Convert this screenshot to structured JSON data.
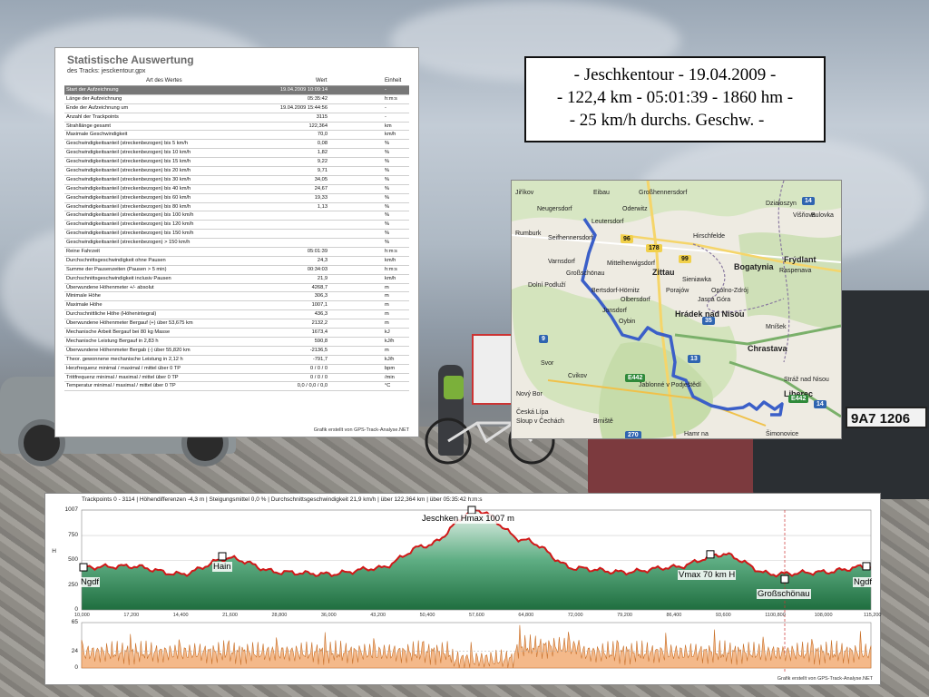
{
  "stats": {
    "title": "Statistische Auswertung",
    "subtitle": "des Tracks: jesckentour.gpx",
    "headers": [
      "Art des Wertes",
      "Wert",
      "Einheit"
    ],
    "rows": [
      {
        "label": "Start der Aufzeichnung",
        "value": "19.04.2009 10:09:14",
        "unit": "-",
        "selected": true
      },
      {
        "label": "Länge der Aufzeichnung",
        "value": "05:35:42",
        "unit": "h:m:s"
      },
      {
        "label": "Ende der Aufzeichnung um",
        "value": "19.04.2009 15:44:56",
        "unit": "-"
      },
      {
        "label": "Anzahl der Trackpoints",
        "value": "3115",
        "unit": "-"
      },
      {
        "label": "Strahllänge gesamt",
        "value": "122,364",
        "unit": "km"
      },
      {
        "label": "Maximale Geschwindigkeit",
        "value": "70,0",
        "unit": "km/h"
      },
      {
        "label": "Geschwindigkeitsanteil  (streckenbezogen)    bis      5 km/h",
        "value": "0,08",
        "unit": "%"
      },
      {
        "label": "Geschwindigkeitsanteil  (streckenbezogen)    bis    10 km/h",
        "value": "1,82",
        "unit": "%"
      },
      {
        "label": "Geschwindigkeitsanteil  (streckenbezogen)    bis    15 km/h",
        "value": "9,22",
        "unit": "%"
      },
      {
        "label": "Geschwindigkeitsanteil  (streckenbezogen)    bis    20 km/h",
        "value": "9,71",
        "unit": "%"
      },
      {
        "label": "Geschwindigkeitsanteil  (streckenbezogen)    bis    30 km/h",
        "value": "34,05",
        "unit": "%"
      },
      {
        "label": "Geschwindigkeitsanteil  (streckenbezogen)    bis    40 km/h",
        "value": "24,67",
        "unit": "%"
      },
      {
        "label": "Geschwindigkeitsanteil  (streckenbezogen)    bis    60 km/h",
        "value": "19,33",
        "unit": "%"
      },
      {
        "label": "Geschwindigkeitsanteil  (streckenbezogen)    bis    80 km/h",
        "value": "1,13",
        "unit": "%"
      },
      {
        "label": "Geschwindigkeitsanteil  (streckenbezogen)    bis  100 km/h",
        "value": "",
        "unit": "%"
      },
      {
        "label": "Geschwindigkeitsanteil  (streckenbezogen)    bis  120 km/h",
        "value": "",
        "unit": "%"
      },
      {
        "label": "Geschwindigkeitsanteil  (streckenbezogen)    bis  150 km/h",
        "value": "",
        "unit": "%"
      },
      {
        "label": "Geschwindigkeitsanteil  (streckenbezogen)     >    150 km/h",
        "value": "",
        "unit": "%"
      },
      {
        "label": "Reine Fahrzeit",
        "value": "05:01:39",
        "unit": "h:m:s"
      },
      {
        "label": "Durchschnittsgeschwindigkeit ohne Pausen",
        "value": "24,3",
        "unit": "km/h"
      },
      {
        "label": "Summe der Pausenzeiten (Pausen > 5 min)",
        "value": "00:34:03",
        "unit": "h:m:s"
      },
      {
        "label": "Durchschnittsgeschwindigkeit inclusiv Pausen",
        "value": "21,9",
        "unit": "km/h"
      },
      {
        "label": "Überwundene Höhenmeter +/- absolut",
        "value": "4268,7",
        "unit": "m"
      },
      {
        "label": "Minimale Höhe",
        "value": "306,3",
        "unit": "m"
      },
      {
        "label": "Maximale Höhe",
        "value": "1007,1",
        "unit": "m"
      },
      {
        "label": "Durchschnittliche Höhe (Höhenintegral)",
        "value": "436,3",
        "unit": "m"
      },
      {
        "label": "Überwundene Höhenmeter Bergauf (+)  über 53,675 km",
        "value": "2132,2",
        "unit": "m"
      },
      {
        "label": "Mechanische Arbeit Bergauf bei   80 kg   Masse",
        "value": "1673,4",
        "unit": "kJ"
      },
      {
        "label": "Mechanische Leistung Bergauf in    2,83 h",
        "value": "590,8",
        "unit": "kJ/h"
      },
      {
        "label": "Überwundene Höhenmeter Bergab (-)  über 55,820 km",
        "value": "-2136,5",
        "unit": "m"
      },
      {
        "label": "Theor. gewonnene mechanische Leistung in    2,12 h",
        "value": "-791,7",
        "unit": "kJ/h"
      },
      {
        "label": "Herzfrequenz minimal / maximal / mittel  über 0 TP",
        "value": "0 / 0 / 0",
        "unit": "bpm"
      },
      {
        "label": "Trittfrequenz minimal / maximal / mittel  über 0 TP",
        "value": "0 / 0 / 0",
        "unit": "/min"
      },
      {
        "label": "Temperatur minimal / maximal / mittel  über 0 TP",
        "value": "0,0 / 0,0 / 0,0",
        "unit": "°C"
      }
    ],
    "footer": "Grafik erstellt von GPS-Track-Analyse.NET"
  },
  "titlebox": {
    "line1": "- Jeschkentour - 19.04.2009 -",
    "line2": "- 122,4 km - 05:01:39 - 1860 hm -",
    "line3": "- 25 km/h durchs. Geschw. -"
  },
  "map": {
    "places": [
      "Jiříkov",
      "Eibau",
      "Großhennersdorf",
      "Neugersdorf",
      "Oderwitz",
      "Rumburk",
      "Leutersdorf",
      "Seifhennersdorf",
      "Hirschfelde",
      "Varnsdorf",
      "Großschönau",
      "Mittelherwigsdorf",
      "Zittau",
      "Sieniawka",
      "Bogatynia",
      "Bertsdorf-Hörnitz",
      "Porajów",
      "Opolno-Zdrój",
      "Jasná Góra",
      "Dolní Podluží",
      "Olbersdorf",
      "Jonsdorf",
      "Oybin",
      "Hrádek nad Nisou",
      "Chrastava",
      "Svor",
      "Cvikov",
      "Jablonné v Podještědí",
      "Nový Bor",
      "Brniště",
      "Hamr na",
      "Liberec",
      "Stráž nad Nisou",
      "Mníšek",
      "Frýdlant",
      "Raspenava",
      "Višňova",
      "Bulovka",
      "Działoszyn",
      "Šimonovice",
      "Česká Lípa",
      "Sloup v Čechách"
    ],
    "road_numbers": [
      "96",
      "178",
      "99",
      "35",
      "13",
      "9",
      "E442",
      "14",
      "270"
    ]
  },
  "profile": {
    "header": "Trackpoints 0 - 3114  |  Höhendifferenzen  -4,3 m  |  Steigungsmittel  0,0 %  |  Durchschnittsgeschwindigkeit  21,9 km/h  |  über  122,364 km  |  über  05:35:42 h:m:s",
    "footer": "Grafik erstellt von GPS-Track-Analyse.NET",
    "axis_label": "H",
    "elevation_ticks": [
      "1007",
      "750",
      "500",
      "250",
      "0"
    ],
    "speed_ticks": [
      "65",
      "24",
      "0"
    ],
    "distance_ticks": [
      "10,000",
      "17,200",
      "14,400",
      "21,600",
      "28,800",
      "36,000",
      "43,200",
      "50,400",
      "57,600",
      "64,800",
      "72,000",
      "79,200",
      "86,400",
      "93,600",
      "1100,800",
      "108,000",
      "115,200"
    ],
    "annotations": {
      "start": "Ngdf",
      "hain": "Hain",
      "summit": "Jeschken Hmax 1007 m",
      "vmax": "Vmax 70 km H",
      "grossschoenau": "Großschönau",
      "end": "Ngdf"
    }
  },
  "background": {
    "plate": "9A7 1206",
    "sky_color": "#aeb9c4",
    "ground_color": "#8f8c86"
  },
  "chart_data": {
    "type": "area",
    "xlabel": "",
    "ylabel": "H",
    "ylim": [
      0,
      1007
    ],
    "x": [
      0,
      7.6,
      15.3,
      22.9,
      30.6,
      38.2,
      45.9,
      53.5,
      61.2,
      68.8,
      76.5,
      84.1,
      91.8,
      99.4,
      107.1,
      114.7,
      122.4
    ],
    "series": [
      {
        "name": "",
        "values": [
          430,
          440,
          360,
          520,
          380,
          360,
          420,
          650,
          1007,
          700,
          420,
          380,
          430,
          560,
          360,
          380,
          440
        ]
      }
    ]
  }
}
